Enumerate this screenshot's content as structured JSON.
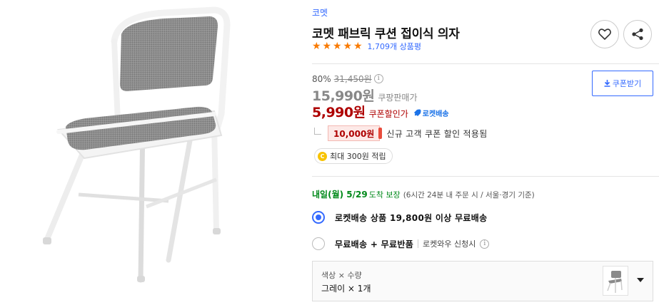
{
  "product": {
    "brand": "코멧",
    "title": "코멧 패브릭 쿠션 접이식 의자",
    "rating": 5,
    "review_count": "1,709개 상품평"
  },
  "pricing": {
    "discount_rate": "80%",
    "original_price": "31,450원",
    "info_icon": "i",
    "sale_price": "15,990원",
    "sale_label": "쿠팡판매가",
    "coupon_price": "5,990원",
    "coupon_label": "쿠폰할인가",
    "rocket_label": "로켓배송",
    "coupon_button": "쿠폰받기"
  },
  "new_user_coupon": {
    "amount": "10,000원",
    "text": "신규 고객 쿠폰 할인 적용됨"
  },
  "cash_reward": {
    "coin": "C",
    "text": "최대 300원 적립"
  },
  "delivery": {
    "arrival": "내일(월) 5/29",
    "guarantee": "도착 보장",
    "note": "(6시간 24분  내 주문 시 / 서울·경기 기준)"
  },
  "shipping_options": [
    {
      "label": "로켓배송 상품 19,800원 이상 무료배송",
      "selected": true
    },
    {
      "label": "무료배송 + 무료반품",
      "sub": "로켓와우 신청시",
      "selected": false
    }
  ],
  "option_selector": {
    "names": "색상 × 수량",
    "values": "그레이 × 1개"
  },
  "icons": {
    "heart": "heart-icon",
    "share": "share-icon",
    "download": "download-icon",
    "rocket": "rocket-icon",
    "caret": "caret-down-icon"
  },
  "colors": {
    "accent": "#346aff",
    "price_red": "#ae0000",
    "star": "#f97a00",
    "arrival_green": "#00891a",
    "chair_fabric": "#8a8a8a",
    "chair_frame": "#f2f2f2"
  }
}
